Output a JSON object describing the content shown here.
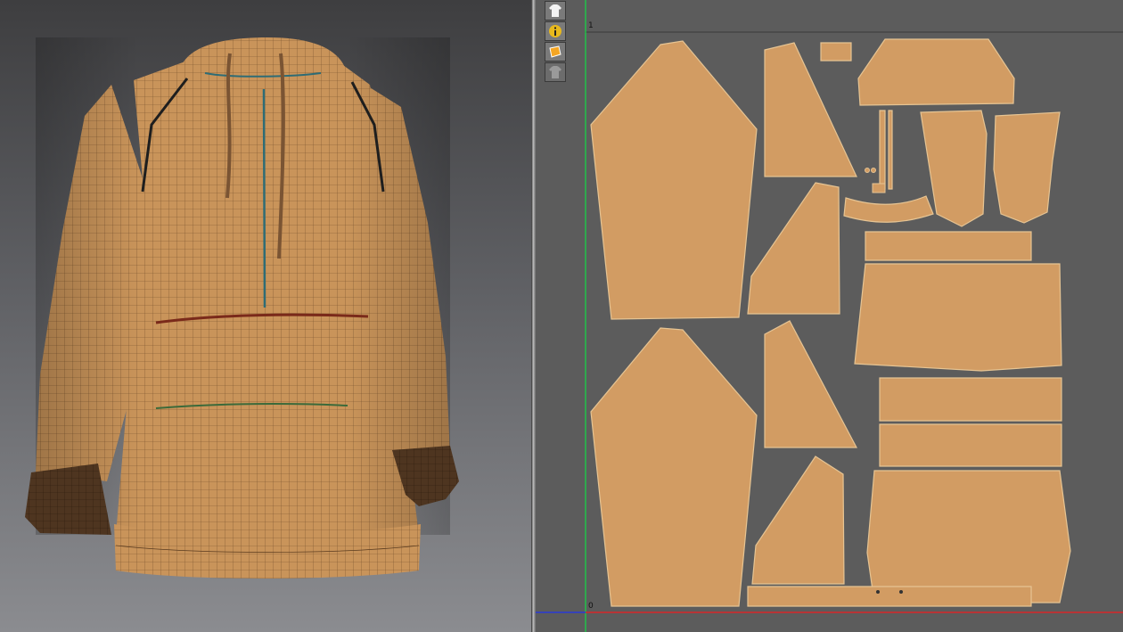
{
  "viewport_3d": {
    "garment": "hoodie-icon",
    "colors": {
      "fabric": "#c9945a",
      "fabric_dark": "#5a3b1f",
      "cuff": "#4e3520",
      "seam_red": "#7a2a1a",
      "seam_green": "#3b6a3a",
      "seam_teal": "#2e6c75"
    }
  },
  "uv_editor": {
    "toolbar": [
      {
        "icon": "shirt-icon"
      },
      {
        "icon": "info-icon"
      },
      {
        "icon": "fabric-swatch-icon"
      },
      {
        "icon": "shirt-disabled-icon"
      }
    ],
    "axis_labels": {
      "top_tick": "1",
      "origin_tick": "0"
    },
    "colors": {
      "background": "#5c5c5c",
      "pattern_piece": "#d29c63",
      "pattern_outline": "#e6c493",
      "axis_x": "#d6262a",
      "axis_y": "#22c24a",
      "grid_border": "#3a3a3a",
      "axis_blue": "#2a3ad6"
    }
  }
}
